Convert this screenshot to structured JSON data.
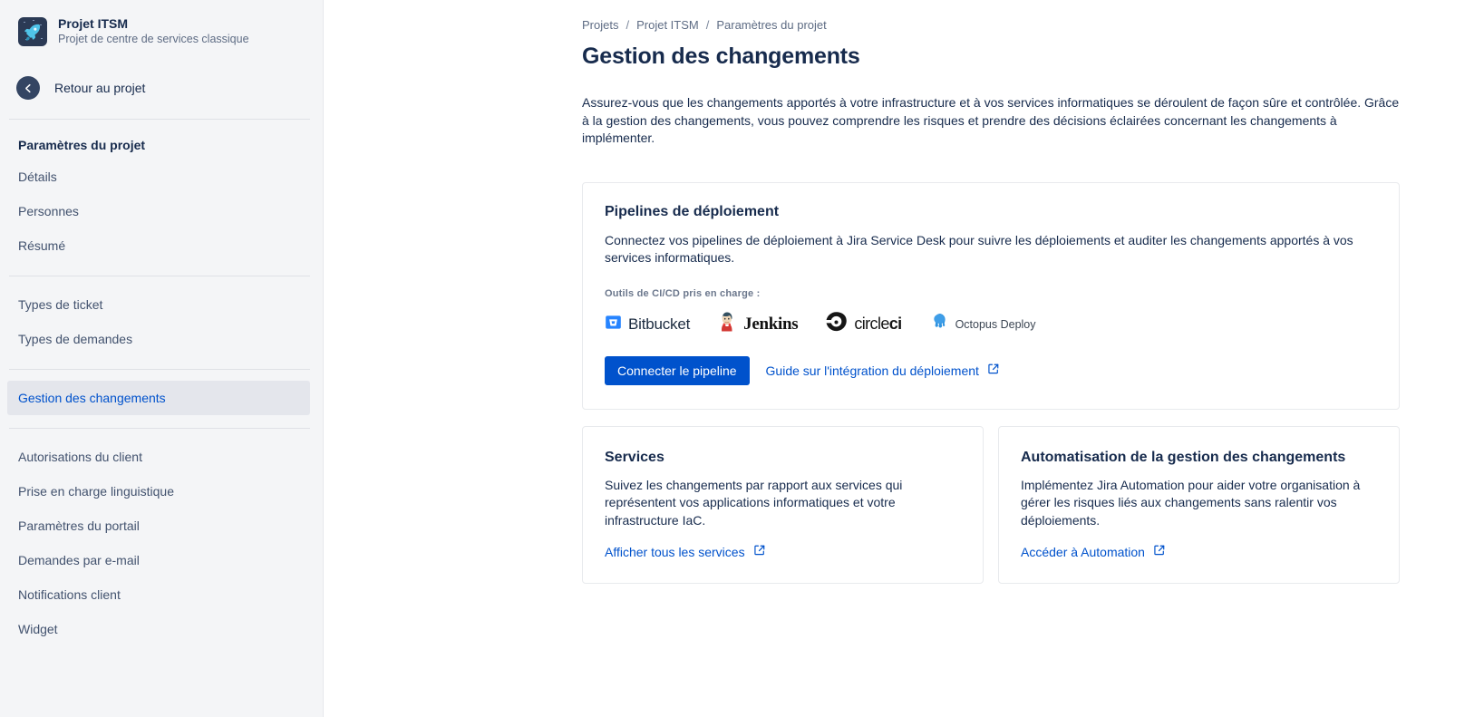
{
  "sidebar": {
    "project": {
      "avatar_icon": "rocket-icon",
      "name": "Projet ITSM",
      "subtitle": "Projet de centre de services classique"
    },
    "back": {
      "icon": "arrow-left-icon",
      "label": "Retour au projet"
    },
    "heading": "Paramètres du projet",
    "group1": [
      {
        "label": "Détails",
        "selected": false
      },
      {
        "label": "Personnes",
        "selected": false
      },
      {
        "label": "Résumé",
        "selected": false
      }
    ],
    "group2": [
      {
        "label": "Types de ticket",
        "selected": false
      },
      {
        "label": "Types de demandes",
        "selected": false
      }
    ],
    "group3": [
      {
        "label": "Gestion des changements",
        "selected": true
      }
    ],
    "group4": [
      {
        "label": "Autorisations du client",
        "selected": false
      },
      {
        "label": "Prise en charge linguistique",
        "selected": false
      },
      {
        "label": "Paramètres du portail",
        "selected": false
      },
      {
        "label": "Demandes par e-mail",
        "selected": false
      },
      {
        "label": "Notifications client",
        "selected": false
      },
      {
        "label": "Widget",
        "selected": false
      }
    ]
  },
  "breadcrumb": {
    "items": [
      "Projets",
      "Projet ITSM",
      "Paramètres du projet"
    ],
    "separator": "/"
  },
  "page": {
    "title": "Gestion des changements",
    "description": "Assurez-vous que les changements apportés à votre infrastructure et à vos services informatiques se déroulent de façon sûre et contrôlée. Grâce à la gestion des changements, vous pouvez comprendre les risques et prendre des décisions éclairées concernant les changements à implémenter."
  },
  "pipeline_card": {
    "title": "Pipelines de déploiement",
    "description": "Connectez vos pipelines de déploiement à Jira Service Desk pour suivre les déploiements et auditer les changements apportés à vos services informatiques.",
    "tools_label": "Outils de CI/CD pris en charge :",
    "tools": [
      {
        "name": "Bitbucket",
        "icon": "bitbucket-logo"
      },
      {
        "name": "Jenkins",
        "icon": "jenkins-logo"
      },
      {
        "name": "circleci",
        "icon": "circleci-logo"
      },
      {
        "name": "Octopus Deploy",
        "icon": "octopus-deploy-logo"
      }
    ],
    "primary_button": "Connecter le pipeline",
    "guide_link": "Guide sur l'intégration du déploiement",
    "guide_link_icon": "external-link-icon"
  },
  "services_card": {
    "title": "Services",
    "description": "Suivez les changements par rapport aux services qui représentent vos applications informatiques et votre infrastructure IaC.",
    "link": "Afficher tous les services",
    "link_icon": "external-link-icon"
  },
  "automation_card": {
    "title": "Automatisation de la gestion des changements",
    "description": "Implémentez Jira Automation pour aider votre organisation à gérer les risques liés aux changements sans ralentir vos déploiements.",
    "link": "Accéder à Automation",
    "link_icon": "external-link-icon"
  },
  "colors": {
    "accent": "#0052cc",
    "sidebar_bg": "#f4f5f7",
    "selected_bg": "#e4e6ec",
    "text": "#172b4d",
    "muted": "#5e6c84"
  }
}
